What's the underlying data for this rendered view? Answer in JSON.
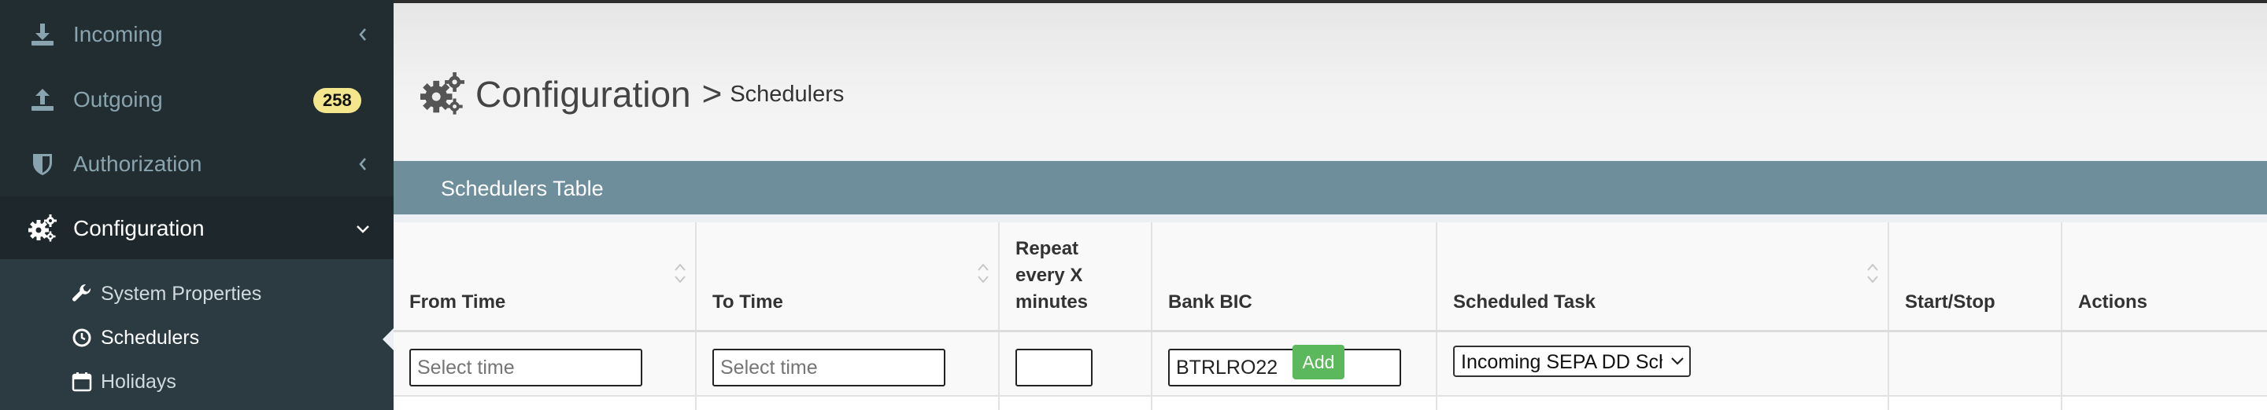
{
  "sidebar": {
    "items": [
      {
        "label": "Incoming",
        "icon": "download-icon"
      },
      {
        "label": "Outgoing",
        "icon": "upload-icon",
        "badge": "258"
      },
      {
        "label": "Authorization",
        "icon": "shield-icon"
      },
      {
        "label": "Configuration",
        "icon": "gears-icon",
        "active": true
      }
    ],
    "submenu": [
      {
        "label": "System Properties",
        "icon": "wrench-icon"
      },
      {
        "label": "Schedulers",
        "icon": "clock-icon",
        "active": true
      },
      {
        "label": "Holidays",
        "icon": "calendar-icon"
      }
    ]
  },
  "page": {
    "title": "Configuration",
    "separator": ">",
    "subtitle": "Schedulers"
  },
  "box": {
    "title": "Schedulers Table"
  },
  "table": {
    "columns": [
      {
        "label": "From Time",
        "sortable": true
      },
      {
        "label": "To Time",
        "sortable": true
      },
      {
        "label": "Repeat every X minutes",
        "sortable": false
      },
      {
        "label": "Bank BIC",
        "sortable": false
      },
      {
        "label": "Scheduled Task",
        "sortable": true
      },
      {
        "label": "Start/Stop",
        "sortable": false
      },
      {
        "label": "Actions",
        "sortable": false
      }
    ],
    "header_lines": {
      "repeat_1": "Repeat",
      "repeat_2": "every X",
      "repeat_3": "minutes"
    },
    "new_row": {
      "from_placeholder": "Select time",
      "to_placeholder": "Select time",
      "repeat_value": "",
      "bank_bic_value": "BTRLRO22",
      "scheduled_task_value": "Incoming SEPA DD Scheduler",
      "add_label": "Add"
    }
  },
  "colors": {
    "sidebar_bg": "#222d32",
    "box_header": "#6e8e9c",
    "badge": "#f4e68c",
    "add_button": "#5cb85c"
  }
}
